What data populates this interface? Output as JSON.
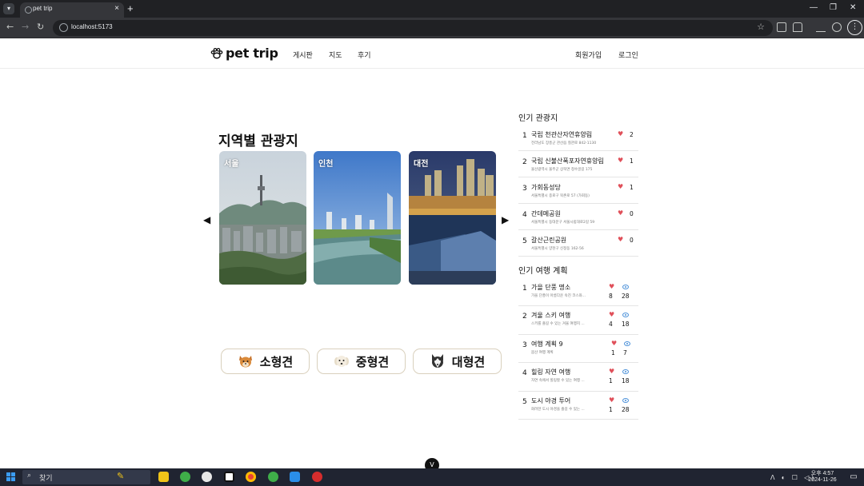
{
  "browser": {
    "tab_title": "pet trip",
    "tab_close": "×",
    "new_tab": "+",
    "url": "localhost:5173",
    "window_controls": {
      "minimize": "—",
      "restore": "❐",
      "close": "✕"
    },
    "nav": {
      "back": "←",
      "forward": "→",
      "reload": "↻",
      "more": "⋮",
      "bookmark": "☆",
      "tab_menu": "▾"
    }
  },
  "header": {
    "logo_text": "pet trip",
    "nav": [
      "게시판",
      "지도",
      "후기"
    ],
    "signup": "회원가입",
    "login": "로그인"
  },
  "regions": {
    "title": "지역별 관광지",
    "prev": "◀",
    "next": "▶",
    "cards": [
      {
        "label": "서울"
      },
      {
        "label": "인천"
      },
      {
        "label": "대전"
      }
    ]
  },
  "dog_sizes": [
    {
      "label": "소형견",
      "icon": "small-dog-icon"
    },
    {
      "label": "중형견",
      "icon": "medium-dog-icon"
    },
    {
      "label": "대형견",
      "icon": "large-dog-icon"
    }
  ],
  "popular_spots": {
    "title": "인기 관광지",
    "items": [
      {
        "rank": "1",
        "name": "국립 천관산자연휴양림",
        "address": "전라남도 장흥군 관산읍 칠관로 842-1130",
        "likes": "2"
      },
      {
        "rank": "2",
        "name": "국립 신불산폭포자연휴양림",
        "address": "울산광역시 울주군 상북면 청수골길 175",
        "likes": "1"
      },
      {
        "rank": "3",
        "name": "가회동성당",
        "address": "서울특별시 종로구 북촌로 57 (가회동)",
        "likes": "1"
      },
      {
        "rank": "4",
        "name": "간데메공원",
        "address": "서울특별시 동대문구 서울시립대로2길 59",
        "likes": "0"
      },
      {
        "rank": "5",
        "name": "갈산근린공원",
        "address": "서울특별시 양천구 신정동 162-56",
        "likes": "0"
      }
    ]
  },
  "popular_plans": {
    "title": "인기 여행 계획",
    "items": [
      {
        "rank": "1",
        "name": "가을 단풍 명소",
        "desc": "가을 단풍이 아름다운 숙진 코스와...",
        "likes": "8",
        "views": "28"
      },
      {
        "rank": "2",
        "name": "겨울 스키 여행",
        "desc": "스키를 즐길 수 있는 겨울 여행지 ...",
        "likes": "4",
        "views": "18"
      },
      {
        "rank": "3",
        "name": "여행 계획 9",
        "desc": "봄산 여행 계획",
        "likes": "1",
        "views": "7"
      },
      {
        "rank": "4",
        "name": "힐링 자연 여행",
        "desc": "자연 속에서 힐링할 수 있는 여행 ...",
        "likes": "1",
        "views": "18"
      },
      {
        "rank": "5",
        "name": "도시 야경 투어",
        "desc": "화려한 도시 야경을 즐길 수 있는 ...",
        "likes": "1",
        "views": "28"
      }
    ]
  },
  "scroll_button": "V",
  "taskbar": {
    "search_placeholder": "찾기",
    "search_icon": "⌕",
    "time": "오후 4:57",
    "date": "2024-11-26"
  },
  "colors": {
    "heart": "#e0505a",
    "eye": "#4a90d9",
    "button_border": "#d9d0bd",
    "chrome_dark": "#202124"
  }
}
